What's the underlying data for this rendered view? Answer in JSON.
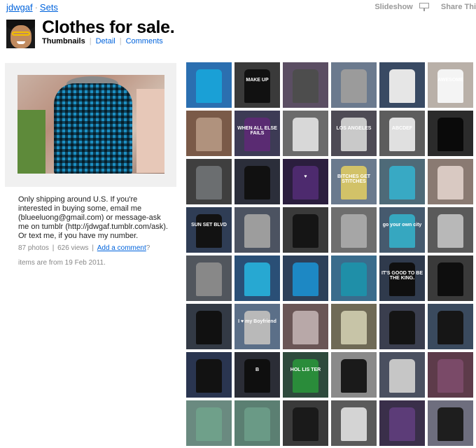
{
  "nav": {
    "user": "jdwgaf",
    "separator": "·",
    "sets": "Sets"
  },
  "tools": {
    "slideshow": "Slideshow",
    "share": "Share Thi"
  },
  "header": {
    "title": "Clothes for sale.",
    "tabs": {
      "thumbnails": "Thumbnails",
      "detail": "Detail",
      "comments": "Comments"
    }
  },
  "description": "Only shipping around U.S. If you're interested in buying some, email me (blueeluong@gmail.com) or message-ask me on tumblr (http://jdwgaf.tumblr.com/ask). Or text me, if you have my number.",
  "stats": {
    "photos": "87 photos",
    "views": "626 views",
    "add_comment": "Add a comment",
    "question": "?"
  },
  "dateline": "items are from 19 Feb 2011.",
  "thumbnails": [
    {
      "bg": "#2b6fb0",
      "fg": "#1aa0d6",
      "text": ""
    },
    {
      "bg": "#3a3a3a",
      "fg": "#111111",
      "text": "MAKE UP"
    },
    {
      "bg": "#5b4e63",
      "fg": "#4d4d4d",
      "text": ""
    },
    {
      "bg": "#6b7a8e",
      "fg": "#9b9b9b",
      "text": ""
    },
    {
      "bg": "#394a63",
      "fg": "#e6e6e6",
      "text": ""
    },
    {
      "bg": "#b9b0a8",
      "fg": "#f4f4f4",
      "text": "AWESOME"
    },
    {
      "bg": "#7a5a48",
      "fg": "#b0927d",
      "text": ""
    },
    {
      "bg": "#3d3b55",
      "fg": "#5a2b72",
      "text": "WHEN ALL ELSE FAILS"
    },
    {
      "bg": "#6b6b6b",
      "fg": "#d8d8d8",
      "text": ""
    },
    {
      "bg": "#4e4b55",
      "fg": "#c9c9c9",
      "text": "LOS ANGELES"
    },
    {
      "bg": "#5d5d5d",
      "fg": "#e0e0e0",
      "text": "ABCDEF"
    },
    {
      "bg": "#2b2b2b",
      "fg": "#0a0a0a",
      "text": ""
    },
    {
      "bg": "#3f3f3f",
      "fg": "#6b6e70",
      "text": ""
    },
    {
      "bg": "#2b2e3a",
      "fg": "#111111",
      "text": ""
    },
    {
      "bg": "#2b1e3e",
      "fg": "#4d2a6e",
      "text": "♥"
    },
    {
      "bg": "#6a7a8e",
      "fg": "#d2c268",
      "text": "BITCHES GET STITCHES"
    },
    {
      "bg": "#4e6a78",
      "fg": "#38a9c4",
      "text": ""
    },
    {
      "bg": "#8a7a72",
      "fg": "#d9c9c2",
      "text": ""
    },
    {
      "bg": "#2f3d55",
      "fg": "#121212",
      "text": "SUN SET BLVD"
    },
    {
      "bg": "#4c5361",
      "fg": "#9d9d9d",
      "text": ""
    },
    {
      "bg": "#3a3a3a",
      "fg": "#151515",
      "text": ""
    },
    {
      "bg": "#6e6e6e",
      "fg": "#a6a6a6",
      "text": ""
    },
    {
      "bg": "#465a6e",
      "fg": "#36a7c0",
      "text": "go your own city"
    },
    {
      "bg": "#5a5a5a",
      "fg": "#b8b8b8",
      "text": ""
    },
    {
      "bg": "#51565d",
      "fg": "#888888",
      "text": ""
    },
    {
      "bg": "#2a4f76",
      "fg": "#27a8d2",
      "text": ""
    },
    {
      "bg": "#2d4059",
      "fg": "#1d88c4",
      "text": ""
    },
    {
      "bg": "#3a6c8c",
      "fg": "#1f8fa8",
      "text": ""
    },
    {
      "bg": "#2f3a4c",
      "fg": "#0f0f0f",
      "text": "IT'S GOOD TO BE THE KING."
    },
    {
      "bg": "#3a3a3a",
      "fg": "#0e0e0e",
      "text": ""
    },
    {
      "bg": "#333a45",
      "fg": "#111111",
      "text": ""
    },
    {
      "bg": "#5b6f88",
      "fg": "#b9b9b9",
      "text": "I ♥ my Boyfriend"
    },
    {
      "bg": "#6a5656",
      "fg": "#b8a8a8",
      "text": ""
    },
    {
      "bg": "#6f6a56",
      "fg": "#c7c4a7",
      "text": ""
    },
    {
      "bg": "#3a3e4e",
      "fg": "#141414",
      "text": ""
    },
    {
      "bg": "#3a4a5e",
      "fg": "#161616",
      "text": ""
    },
    {
      "bg": "#2a3550",
      "fg": "#121212",
      "text": ""
    },
    {
      "bg": "#2b2d36",
      "fg": "#0f0f0f",
      "text": "B"
    },
    {
      "bg": "#2e4a3c",
      "fg": "#2a8c3a",
      "text": "HOL LIS TER"
    },
    {
      "bg": "#8a8a8a",
      "fg": "#1a1a1a",
      "text": ""
    },
    {
      "bg": "#4a5060",
      "fg": "#c6c6c6",
      "text": ""
    },
    {
      "bg": "#5d3b4a",
      "fg": "#7a4a68",
      "text": ""
    },
    {
      "bg": "#6a8a80",
      "fg": "#6fa08a",
      "text": ""
    },
    {
      "bg": "#5b7f72",
      "fg": "#6a9a86",
      "text": ""
    },
    {
      "bg": "#3a3a3a",
      "fg": "#1a1a1a",
      "text": ""
    },
    {
      "bg": "#5a5a5a",
      "fg": "#d4d4d4",
      "text": ""
    },
    {
      "bg": "#3a2f4a",
      "fg": "#5c3c78",
      "text": ""
    },
    {
      "bg": "#6e6e7e",
      "fg": "#1e1e1e",
      "text": ""
    }
  ]
}
